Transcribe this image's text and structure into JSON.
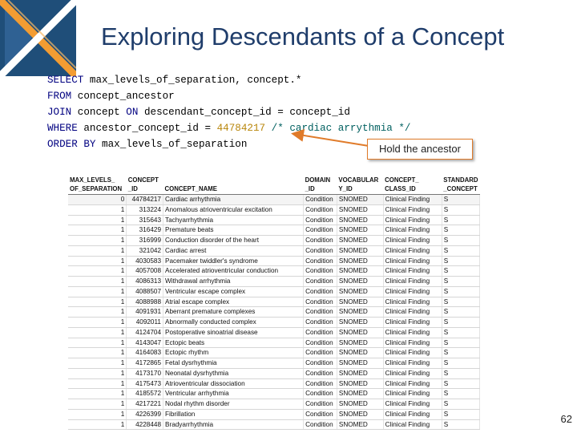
{
  "slide": {
    "title": "Exploring Descendants of a Concept",
    "page_number": "62",
    "logo_colors": [
      "#1f4e79",
      "#f39c32",
      "#ffffff"
    ]
  },
  "sql": {
    "lines": [
      [
        {
          "t": "SELECT",
          "c": "kw"
        },
        {
          "t": " max_levels_of_separation, concept.*",
          "c": "plain"
        }
      ],
      [
        {
          "t": "FROM",
          "c": "kw"
        },
        {
          "t": " concept_ancestor",
          "c": "plain"
        }
      ],
      [
        {
          "t": "JOIN",
          "c": "kw"
        },
        {
          "t": " concept ",
          "c": "plain"
        },
        {
          "t": "ON",
          "c": "kw"
        },
        {
          "t": " descendant_concept_id = concept_id",
          "c": "plain"
        }
      ],
      [
        {
          "t": "WHERE",
          "c": "kw"
        },
        {
          "t": " ancestor_concept_id = ",
          "c": "plain"
        },
        {
          "t": "44784217",
          "c": "num"
        },
        {
          "t": " ",
          "c": "plain"
        },
        {
          "t": "/* cardiac arrythmia */",
          "c": "cmt"
        }
      ],
      [
        {
          "t": "ORDER BY",
          "c": "kw"
        },
        {
          "t": " max_levels_of_separation",
          "c": "plain"
        }
      ]
    ]
  },
  "callout": {
    "text": "Hold the ancestor",
    "border_color": "#e07b2a"
  },
  "table": {
    "headers": [
      {
        "l1": "MAX_LEVELS_",
        "l2": "OF_SEPARATION"
      },
      {
        "l1": "CONCEPT",
        "l2": "_ID"
      },
      {
        "l1": "",
        "l2": "CONCEPT_NAME"
      },
      {
        "l1": "DOMAIN",
        "l2": "_ID"
      },
      {
        "l1": "VOCABULAR",
        "l2": "Y_ID"
      },
      {
        "l1": "CONCEPT_",
        "l2": "CLASS_ID"
      },
      {
        "l1": "STANDARD",
        "l2": "_CONCEPT"
      }
    ],
    "rows": [
      [
        "0",
        "44784217",
        "Cardiac arrhythmia",
        "Condition",
        "SNOMED",
        "Clinical Finding",
        "S"
      ],
      [
        "1",
        "313224",
        "Anomalous atrioventricular excitation",
        "Condition",
        "SNOMED",
        "Clinical Finding",
        "S"
      ],
      [
        "1",
        "315643",
        "Tachyarrhythmia",
        "Condition",
        "SNOMED",
        "Clinical Finding",
        "S"
      ],
      [
        "1",
        "316429",
        "Premature beats",
        "Condition",
        "SNOMED",
        "Clinical Finding",
        "S"
      ],
      [
        "1",
        "316999",
        "Conduction disorder of the heart",
        "Condition",
        "SNOMED",
        "Clinical Finding",
        "S"
      ],
      [
        "1",
        "321042",
        "Cardiac arrest",
        "Condition",
        "SNOMED",
        "Clinical Finding",
        "S"
      ],
      [
        "1",
        "4030583",
        "Pacemaker twiddler's syndrome",
        "Condition",
        "SNOMED",
        "Clinical Finding",
        "S"
      ],
      [
        "1",
        "4057008",
        "Accelerated atrioventricular conduction",
        "Condition",
        "SNOMED",
        "Clinical Finding",
        "S"
      ],
      [
        "1",
        "4086313",
        "Withdrawal arrhythmia",
        "Condition",
        "SNOMED",
        "Clinical Finding",
        "S"
      ],
      [
        "1",
        "4088507",
        "Ventricular escape complex",
        "Condition",
        "SNOMED",
        "Clinical Finding",
        "S"
      ],
      [
        "1",
        "4088988",
        "Atrial escape complex",
        "Condition",
        "SNOMED",
        "Clinical Finding",
        "S"
      ],
      [
        "1",
        "4091931",
        "Aberrant premature complexes",
        "Condition",
        "SNOMED",
        "Clinical Finding",
        "S"
      ],
      [
        "1",
        "4092011",
        "Abnormally conducted complex",
        "Condition",
        "SNOMED",
        "Clinical Finding",
        "S"
      ],
      [
        "1",
        "4124704",
        "Postoperative sinoatrial disease",
        "Condition",
        "SNOMED",
        "Clinical Finding",
        "S"
      ],
      [
        "1",
        "4143047",
        "Ectopic beats",
        "Condition",
        "SNOMED",
        "Clinical Finding",
        "S"
      ],
      [
        "1",
        "4164083",
        "Ectopic rhythm",
        "Condition",
        "SNOMED",
        "Clinical Finding",
        "S"
      ],
      [
        "1",
        "4172865",
        "Fetal dysrhythmia",
        "Condition",
        "SNOMED",
        "Clinical Finding",
        "S"
      ],
      [
        "1",
        "4173170",
        "Neonatal dysrhythmia",
        "Condition",
        "SNOMED",
        "Clinical Finding",
        "S"
      ],
      [
        "1",
        "4175473",
        "Atrioventricular dissociation",
        "Condition",
        "SNOMED",
        "Clinical Finding",
        "S"
      ],
      [
        "1",
        "4185572",
        "Ventricular arrhythmia",
        "Condition",
        "SNOMED",
        "Clinical Finding",
        "S"
      ],
      [
        "1",
        "4217221",
        "Nodal rhythm disorder",
        "Condition",
        "SNOMED",
        "Clinical Finding",
        "S"
      ],
      [
        "1",
        "4226399",
        "Fibrillation",
        "Condition",
        "SNOMED",
        "Clinical Finding",
        "S"
      ],
      [
        "1",
        "4228448",
        "Bradyarrhythmia",
        "Condition",
        "SNOMED",
        "Clinical Finding",
        "S"
      ]
    ]
  }
}
